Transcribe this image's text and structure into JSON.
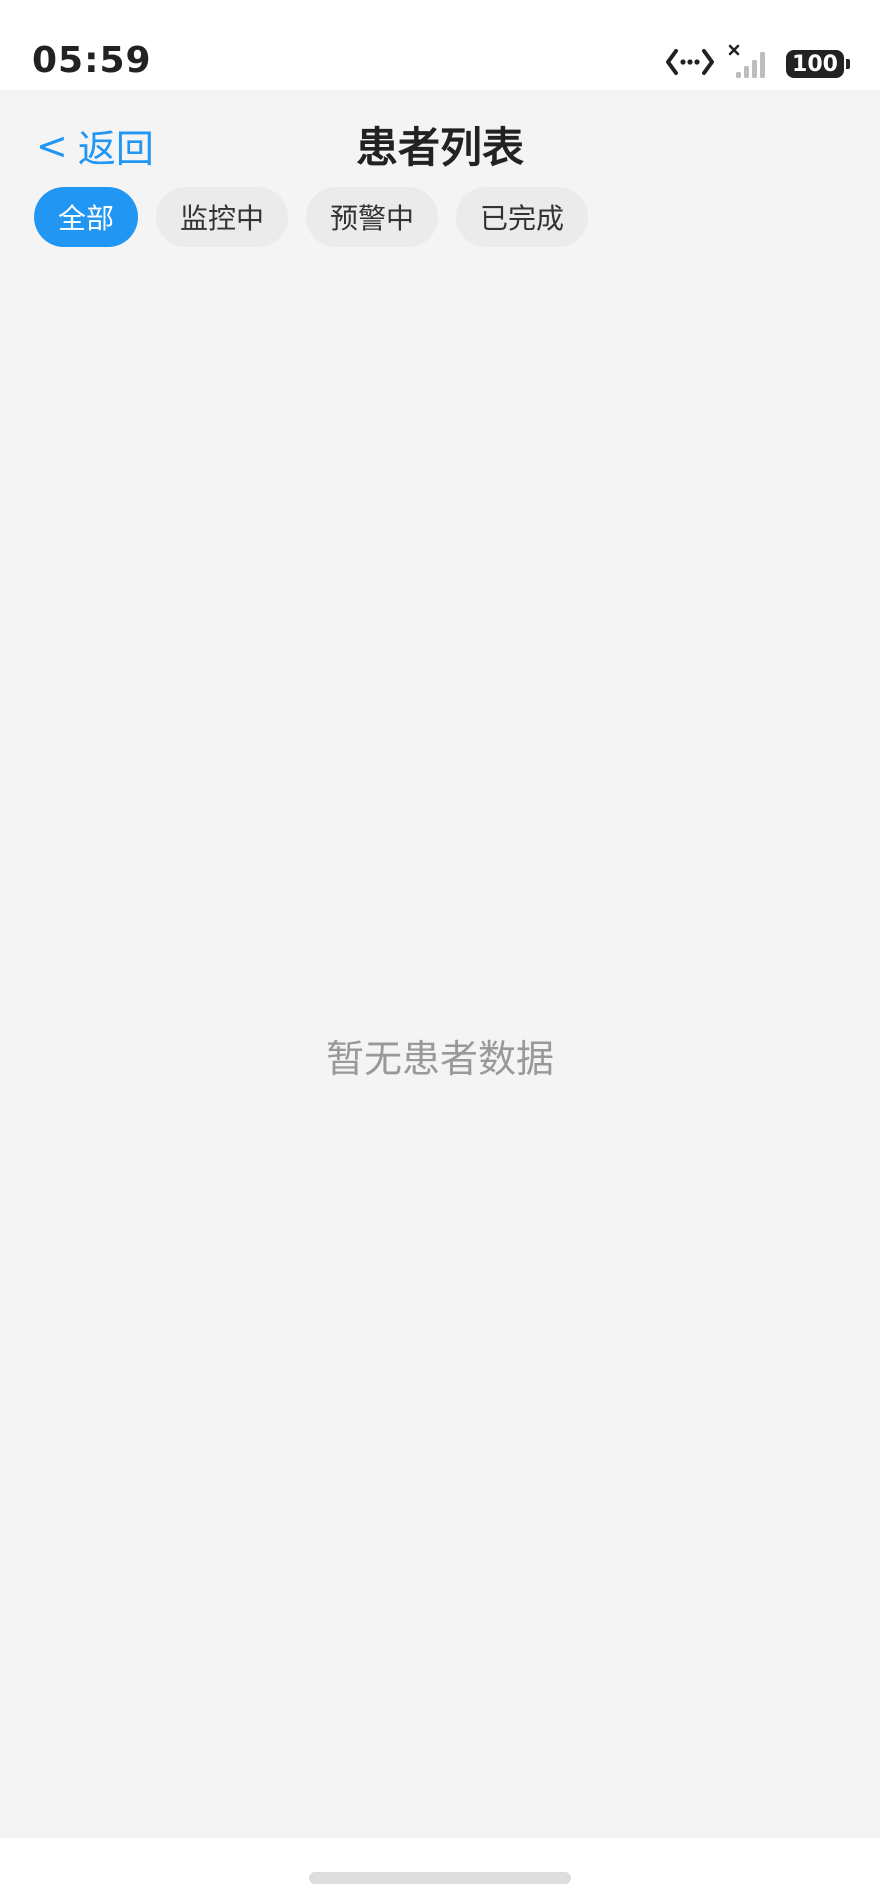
{
  "status_bar": {
    "time": "05:59",
    "battery": "100",
    "icons": [
      "data-transfer-icon",
      "no-signal-icon",
      "battery-icon"
    ]
  },
  "header": {
    "back_arrow": "<",
    "back_label": "返回",
    "title": "患者列表"
  },
  "filters": {
    "tabs": [
      {
        "label": "全部",
        "active": true
      },
      {
        "label": "监控中",
        "active": false
      },
      {
        "label": "预警中",
        "active": false
      },
      {
        "label": "已完成",
        "active": false
      }
    ]
  },
  "main": {
    "empty_message": "暂无患者数据"
  },
  "colors": {
    "accent": "#2196f3",
    "background": "#f4f4f4",
    "tab_inactive": "#ebebeb",
    "muted_text": "#999999"
  }
}
